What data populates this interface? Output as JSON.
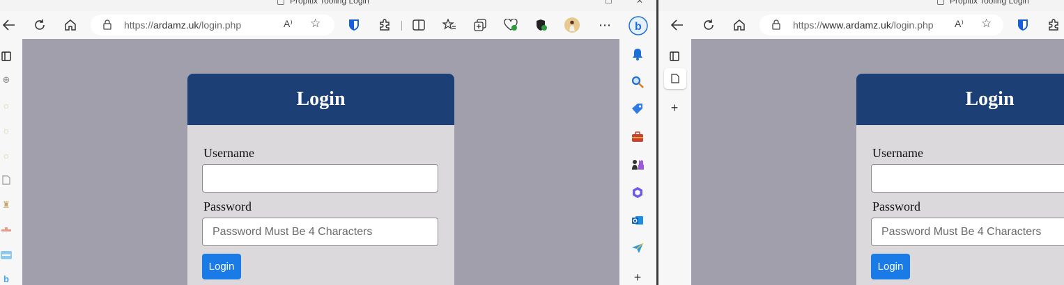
{
  "left_window": {
    "tab_title": "Propitix Tooling Login",
    "url_scheme": "https://",
    "url_domain": "ardamz.uk",
    "url_path": "/login.php"
  },
  "right_window": {
    "tab_title": "Propitix Tooling Login",
    "url_scheme": "https://",
    "url_domain": "www.ardamz.uk",
    "url_path": "/login.php"
  },
  "toolbar": {
    "read_aloud_glyph": "A⁾",
    "more_glyph": "⋯"
  },
  "login_form": {
    "title": "Login",
    "username_label": "Username",
    "username_value": "",
    "password_label": "Password",
    "password_placeholder": "Password Must Be 4 Characters",
    "submit_label": "Login"
  },
  "icons": {
    "back": "back-arrow-icon",
    "refresh": "refresh-icon",
    "home": "home-icon",
    "lock": "lock-icon",
    "favorite": "star-icon",
    "bing": "bing-icon"
  },
  "colors": {
    "page_background": "#a09fab",
    "card_header": "#1c4076",
    "card_body": "#dbd9db",
    "button": "#1a7ae6"
  }
}
